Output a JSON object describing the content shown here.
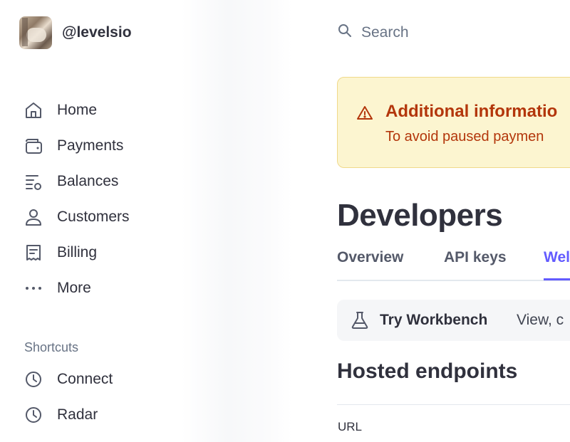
{
  "account": {
    "username": "@levelsio"
  },
  "sidebar": {
    "items": [
      {
        "label": "Home",
        "icon": "home-icon"
      },
      {
        "label": "Payments",
        "icon": "wallet-icon"
      },
      {
        "label": "Balances",
        "icon": "balances-icon"
      },
      {
        "label": "Customers",
        "icon": "person-icon"
      },
      {
        "label": "Billing",
        "icon": "receipt-icon"
      },
      {
        "label": "More",
        "icon": "more-icon"
      }
    ],
    "shortcuts_title": "Shortcuts",
    "shortcuts": [
      {
        "label": "Connect",
        "icon": "clock-icon"
      },
      {
        "label": "Radar",
        "icon": "clock-icon"
      }
    ]
  },
  "search": {
    "label": "Search",
    "icon": "search-icon"
  },
  "banner": {
    "title": "Additional informatio",
    "text": "To avoid paused paymen",
    "icon": "warning-icon",
    "color": "#b3360b",
    "background": "#fcf5d0"
  },
  "page": {
    "title": "Developers"
  },
  "tabs": [
    {
      "label": "Overview",
      "active": false
    },
    {
      "label": "API keys",
      "active": false
    },
    {
      "label": "Wel",
      "active": true
    }
  ],
  "workbench": {
    "title": "Try Workbench",
    "description": "View, c",
    "icon": "flask-icon"
  },
  "hosted": {
    "title": "Hosted endpoints",
    "column_header": "URL"
  },
  "colors": {
    "accent": "#635bff",
    "text": "#30313d",
    "muted": "#687385"
  }
}
